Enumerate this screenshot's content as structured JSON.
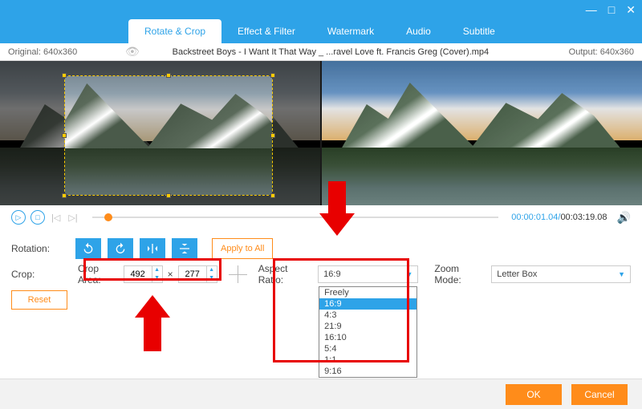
{
  "window": {
    "minimize": "—",
    "maximize": "□",
    "close": "✕"
  },
  "tabs": [
    "Rotate & Crop",
    "Effect & Filter",
    "Watermark",
    "Audio",
    "Subtitle"
  ],
  "activeTab": 0,
  "info": {
    "original": "Original: 640x360",
    "title": "Backstreet Boys - I Want It That Way _ ...ravel Love ft. Francis Greg (Cover).mp4",
    "output": "Output: 640x360"
  },
  "player": {
    "current": "00:00:01.04",
    "duration": "00:03:19.08"
  },
  "rotation": {
    "label": "Rotation:",
    "apply": "Apply to All"
  },
  "crop": {
    "label": "Crop:",
    "areaLabel": "Crop Area:",
    "width": "492",
    "height": "277",
    "times": "×",
    "aspectLabel": "Aspect Ratio:",
    "aspectValue": "16:9",
    "aspectOptions": [
      "Freely",
      "16:9",
      "4:3",
      "21:9",
      "16:10",
      "5:4",
      "1:1",
      "9:16"
    ],
    "aspectSelectedIndex": 1,
    "zoomLabel": "Zoom Mode:",
    "zoomValue": "Letter Box",
    "reset": "Reset"
  },
  "footer": {
    "ok": "OK",
    "cancel": "Cancel"
  }
}
